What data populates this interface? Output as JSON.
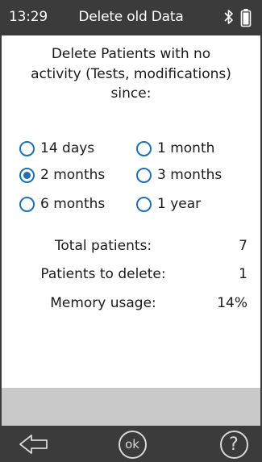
{
  "status_bar": {
    "time": "13:29",
    "title": "Delete old Data",
    "icons": [
      "bluetooth-icon",
      "battery-icon"
    ]
  },
  "prompt": {
    "line1": "Delete Patients with no",
    "line2": "activity (Tests, modifications)",
    "line3": "since:"
  },
  "options": [
    {
      "label": "14 days",
      "selected": false
    },
    {
      "label": "1 month",
      "selected": false
    },
    {
      "label": "2 months",
      "selected": true
    },
    {
      "label": "3 months",
      "selected": false
    },
    {
      "label": "6 months",
      "selected": false
    },
    {
      "label": "1 year",
      "selected": false
    }
  ],
  "stats": {
    "total_patients": {
      "label": "Total patients:",
      "value": "7"
    },
    "patients_to_delete": {
      "label": "Patients to delete:",
      "value": "1"
    },
    "memory_usage": {
      "label": "Memory usage:",
      "value": "14%"
    }
  },
  "nav": {
    "ok_label": "ok",
    "help_label": "?",
    "back_icon": "back-arrow-icon"
  },
  "colors": {
    "bar_background": "#3b3b3b",
    "radio_accent": "#1f6fb4",
    "footer_gray": "#c9c9c9"
  }
}
